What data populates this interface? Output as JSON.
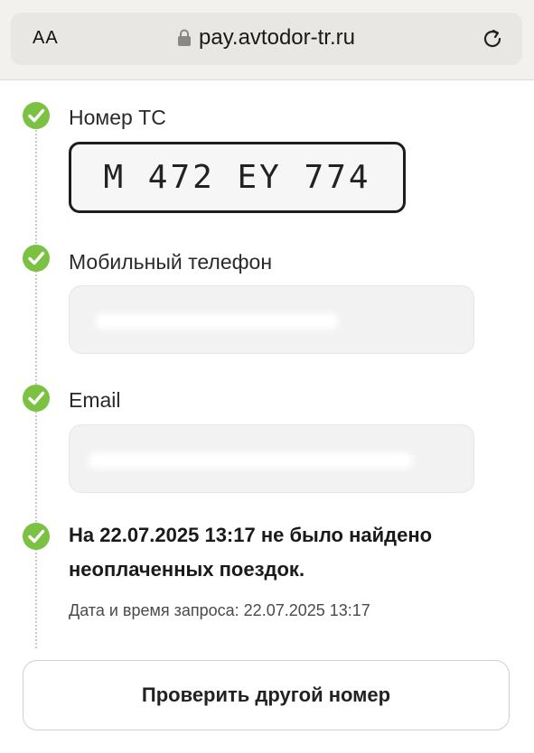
{
  "browser": {
    "text_size_label": "AA",
    "url": "pay.avtodor-tr.ru"
  },
  "form": {
    "plate_label": "Номер ТС",
    "plate_value": "M 472 EY 774",
    "phone_label": "Мобильный телефон",
    "phone_value": "",
    "email_label": "Email",
    "email_value": ""
  },
  "result": {
    "title": "На 22.07.2025 13:17 не было найдено неоплаченных поездок.",
    "request_time": "Дата и время запроса: 22.07.2025 13:17"
  },
  "actions": {
    "check_another_label": "Проверить другой номер"
  },
  "colors": {
    "check_green": "#7cc242",
    "browser_bar": "#f3f1ee"
  },
  "icons": [
    "text-size-icon",
    "lock-icon",
    "reload-icon",
    "check-icon"
  ]
}
